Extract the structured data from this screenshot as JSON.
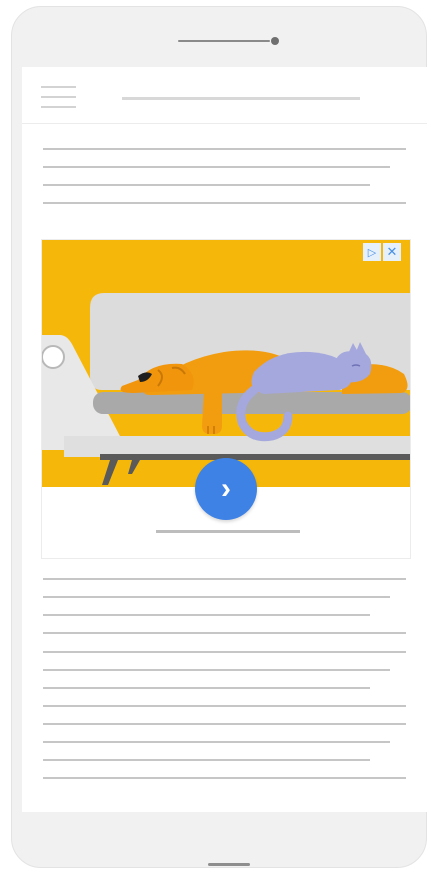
{
  "device": {
    "frame_color": "#f1f1f1",
    "screen_color": "#ffffff"
  },
  "header": {
    "menu_icon": "hamburger-icon"
  },
  "ad": {
    "background_color": "#f6b70b",
    "cta_color": "#3f82e5",
    "cta_icon": "chevron-right-icon",
    "cta_glyph": "›",
    "adchoices_icon": "adchoices-icon",
    "adchoices_glyph": "▷",
    "close_icon": "close-icon",
    "close_glyph": "✕"
  }
}
